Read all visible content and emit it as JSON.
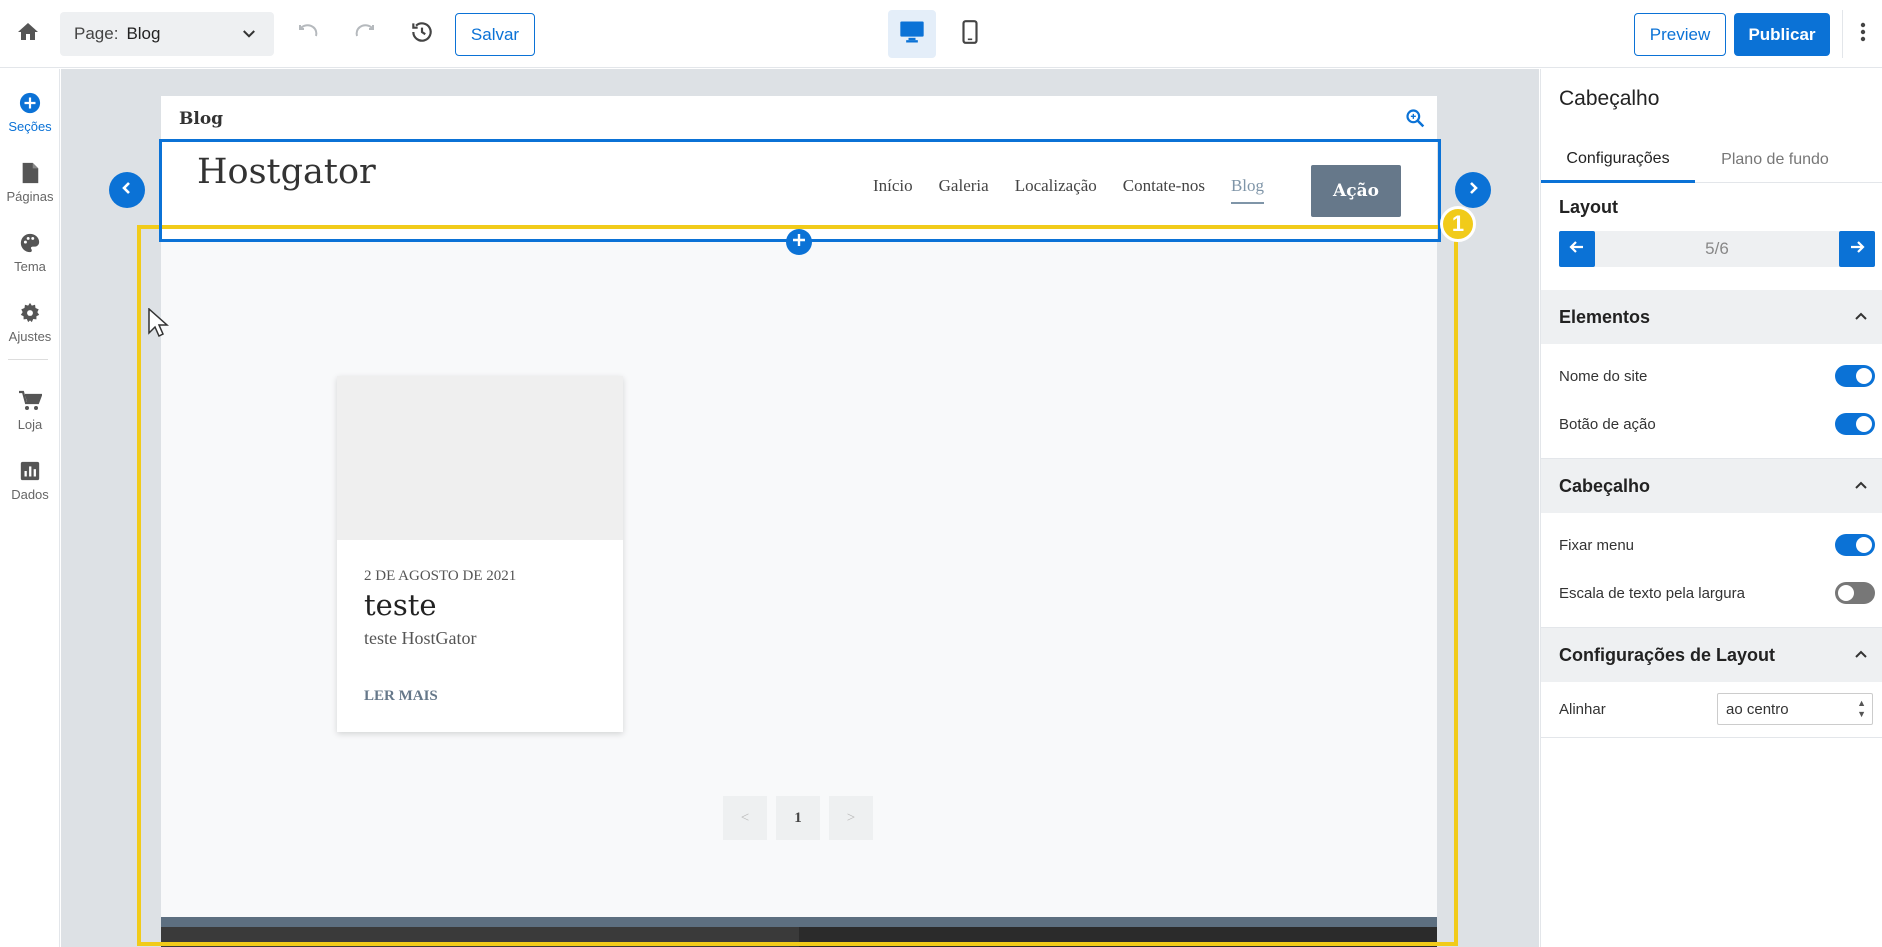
{
  "topbar": {
    "page_label": "Page:",
    "page_value": "Blog",
    "save_label": "Salvar",
    "preview_label": "Preview",
    "publish_label": "Publicar"
  },
  "rail": {
    "items": [
      {
        "label": "Seções",
        "icon": "plus-circle-icon"
      },
      {
        "label": "Páginas",
        "icon": "file-icon"
      },
      {
        "label": "Tema",
        "icon": "palette-icon"
      },
      {
        "label": "Ajustes",
        "icon": "gear-icon"
      },
      {
        "label": "Loja",
        "icon": "cart-icon"
      },
      {
        "label": "Dados",
        "icon": "chart-icon"
      }
    ]
  },
  "site": {
    "top_label": "Blog",
    "title": "Hostgator",
    "nav": [
      "Início",
      "Galeria",
      "Localização",
      "Contate-nos",
      "Blog"
    ],
    "action_label": "Ação",
    "badge": "1",
    "post": {
      "date": "2 DE AGOSTO DE 2021",
      "title": "teste",
      "excerpt": "teste HostGator",
      "more": "LER MAIS"
    },
    "pager": {
      "prev": "<",
      "current": "1",
      "next": ">"
    }
  },
  "panel": {
    "title": "Cabeçalho",
    "tabs": [
      "Configurações",
      "Plano de fundo"
    ],
    "layout_label": "Layout",
    "layout_count": "5/6",
    "groups": {
      "elementos": {
        "title": "Elementos",
        "rows": [
          {
            "label": "Nome do site",
            "on": true
          },
          {
            "label": "Botão de ação",
            "on": true
          }
        ]
      },
      "cabecalho": {
        "title": "Cabeçalho",
        "rows": [
          {
            "label": "Fixar menu",
            "on": true
          },
          {
            "label": "Escala de texto pela largura",
            "on": false
          }
        ]
      },
      "layout": {
        "title": "Configurações de Layout",
        "align_label": "Alinhar",
        "align_value": "ao centro"
      }
    }
  },
  "colors": {
    "accent": "#0b72d6",
    "highlight": "#f1cb1a",
    "action_button": "#66788a"
  }
}
